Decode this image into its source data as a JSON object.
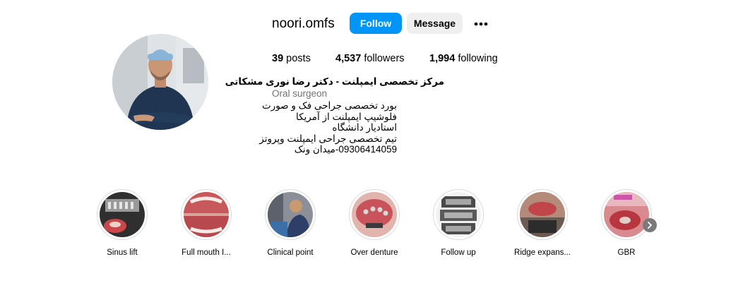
{
  "profile": {
    "username": "noori.omfs",
    "follow_label": "Follow",
    "message_label": "Message",
    "more_icon": "more-dots-icon",
    "posts_count": "39",
    "posts_label": "posts",
    "followers_count": "4,537",
    "followers_label": "followers",
    "following_count": "1,994",
    "following_label": "following",
    "name": "مرکز تخصصی ایمپلنت - دکتر رضا نوری مشکاتی",
    "category": "Oral surgeon",
    "bio_lines": [
      "بورد تخصصی جراحی فک و صورت",
      "فلوشیپ ایمپلنت از آمریکا",
      "استادیار دانشگاه",
      "تیم تخصصی جراحی ایمپلنت وپروتز",
      "09306414059-میدان ونک"
    ]
  },
  "highlights": [
    {
      "label": "Sinus lift"
    },
    {
      "label": "Full mouth I..."
    },
    {
      "label": "Clinical point"
    },
    {
      "label": "Over denture"
    },
    {
      "label": "Follow up"
    },
    {
      "label": "Ridge expans..."
    },
    {
      "label": "GBR"
    }
  ],
  "colors": {
    "follow_button": "#0095f6",
    "message_button": "#efefef",
    "secondary_text": "#737373"
  }
}
